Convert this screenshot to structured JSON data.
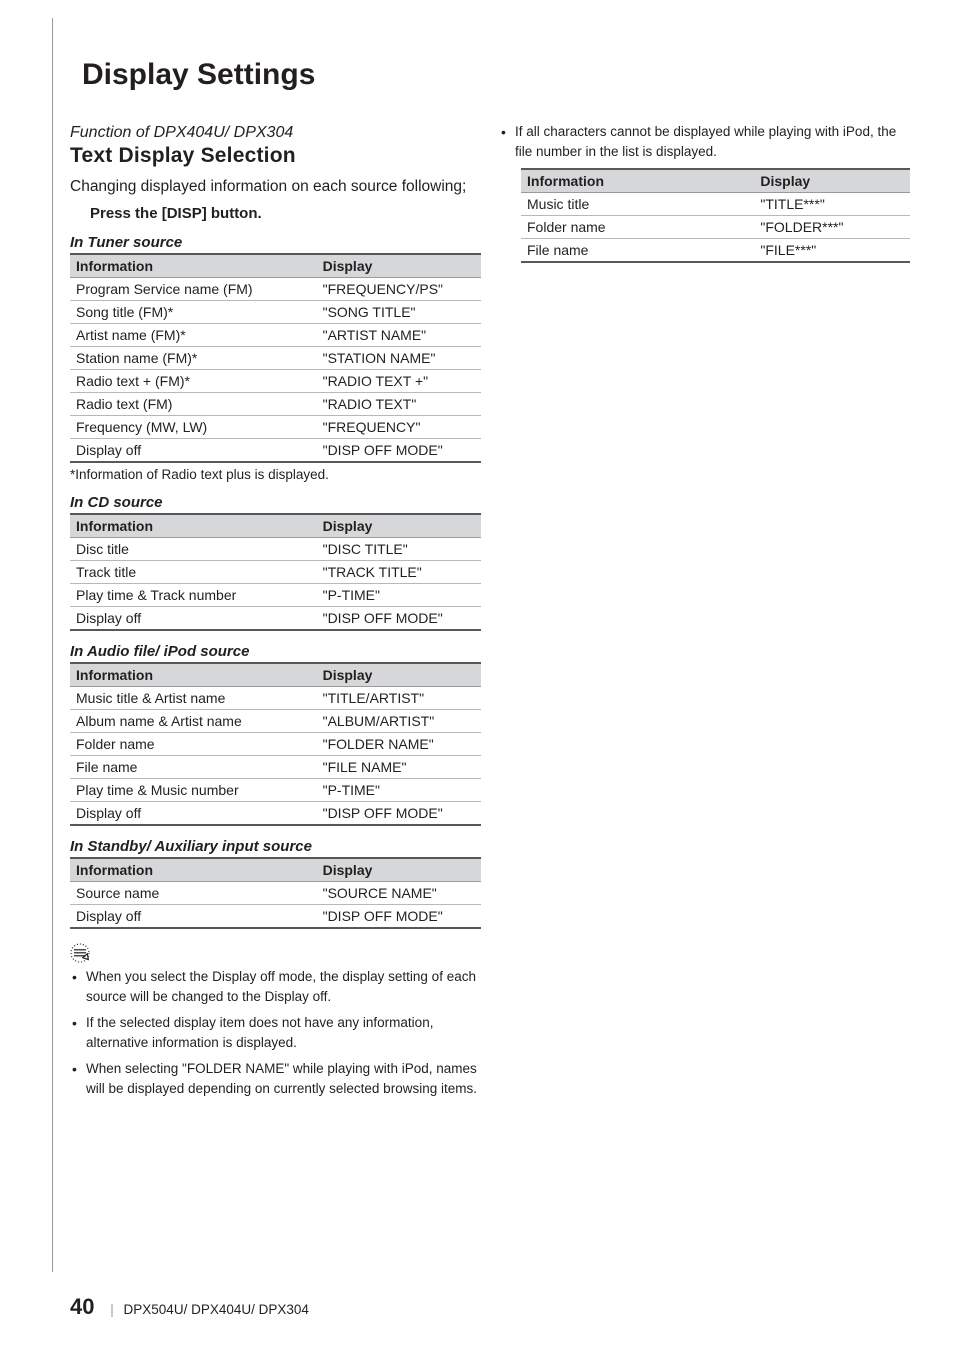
{
  "chapterTitle": "Display Settings",
  "funcNote": "Function of DPX404U/ DPX304",
  "sectionTitle": "Text Display Selection",
  "introPara": "Changing displayed information on each source following;",
  "step1": "Press the [DISP] button.",
  "headers": {
    "info": "Information",
    "disp": "Display"
  },
  "sections": {
    "tuner": {
      "title": "In Tuner source",
      "rows": [
        {
          "info": "Program Service name (FM)",
          "disp": "\"FREQUENCY/PS\""
        },
        {
          "info": "Song title (FM)*",
          "disp": "\"SONG TITLE\""
        },
        {
          "info": "Artist name (FM)*",
          "disp": "\"ARTIST NAME\""
        },
        {
          "info": "Station name (FM)*",
          "disp": "\"STATION NAME\""
        },
        {
          "info": "Radio text + (FM)*",
          "disp": "\"RADIO TEXT +\""
        },
        {
          "info": "Radio text (FM)",
          "disp": "\"RADIO TEXT\""
        },
        {
          "info": "Frequency (MW, LW)",
          "disp": "\"FREQUENCY\""
        },
        {
          "info": "Display off",
          "disp": "\"DISP OFF MODE\""
        }
      ],
      "foot": "*Information of Radio text plus is displayed."
    },
    "cd": {
      "title": "In CD source",
      "rows": [
        {
          "info": "Disc title",
          "disp": "\"DISC TITLE\""
        },
        {
          "info": "Track title",
          "disp": "\"TRACK TITLE\""
        },
        {
          "info": "Play time & Track number",
          "disp": "\"P-TIME\""
        },
        {
          "info": "Display off",
          "disp": "\"DISP OFF MODE\""
        }
      ]
    },
    "audio": {
      "title": "In Audio file/ iPod source",
      "rows": [
        {
          "info": "Music title & Artist name",
          "disp": "\"TITLE/ARTIST\""
        },
        {
          "info": "Album name & Artist name",
          "disp": "\"ALBUM/ARTIST\""
        },
        {
          "info": "Folder name",
          "disp": "\"FOLDER NAME\""
        },
        {
          "info": "File name",
          "disp": "\"FILE NAME\""
        },
        {
          "info": "Play time & Music number",
          "disp": "\"P-TIME\""
        },
        {
          "info": "Display off",
          "disp": "\"DISP OFF MODE\""
        }
      ]
    },
    "standby": {
      "title": "In Standby/ Auxiliary input source",
      "rows": [
        {
          "info": "Source name",
          "disp": "\"SOURCE NAME\""
        },
        {
          "info": "Display off",
          "disp": "\"DISP OFF MODE\""
        }
      ]
    },
    "ipod": {
      "rows": [
        {
          "info": "Music title",
          "disp": "\"TITLE***\""
        },
        {
          "info": "Folder name",
          "disp": "\"FOLDER***\""
        },
        {
          "info": "File name",
          "disp": "\"FILE***\""
        }
      ]
    }
  },
  "notes": [
    "When you select the Display off mode, the display setting of each source will be changed to the Display off.",
    "If the selected display item does not have any information, alternative information is displayed.",
    "When selecting \"FOLDER NAME\" while playing with iPod, names will be displayed depending on currently selected browsing items."
  ],
  "col2Note": "If all characters cannot be displayed while playing with iPod, the file number in the list is displayed.",
  "footer": {
    "page": "40",
    "models": "DPX504U/ DPX404U/ DPX304"
  }
}
